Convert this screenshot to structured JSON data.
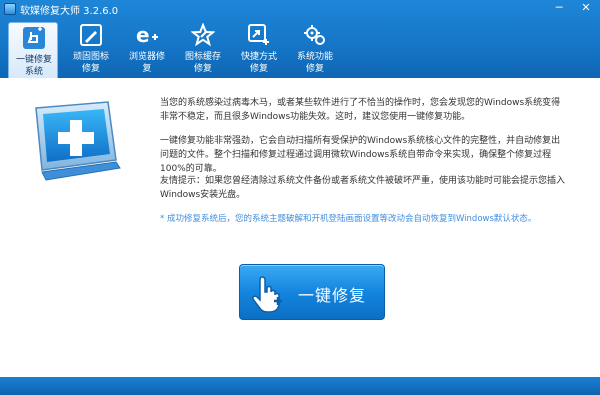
{
  "window": {
    "title": "软媒修复大师 3.2.6.0",
    "min_label": "─",
    "close_label": "✕"
  },
  "toolbar": {
    "items": [
      {
        "label": "一键修复\n系统",
        "icon": "hand-plus-icon",
        "active": true
      },
      {
        "label": "顽固图标\n修复",
        "icon": "brush-icon",
        "active": false
      },
      {
        "label": "浏览器修\n复",
        "icon": "ie-plus-icon",
        "active": false
      },
      {
        "label": "图标缓存\n修复",
        "icon": "star-icon",
        "active": false
      },
      {
        "label": "快捷方式\n修复",
        "icon": "shortcut-icon",
        "active": false
      },
      {
        "label": "系统功能\n修复",
        "icon": "gears-icon",
        "active": false
      }
    ]
  },
  "main": {
    "paragraph1": "当您的系统感染过病毒木马，或者某些软件进行了不恰当的操作时，您会发现您的Windows系统变得非常不稳定，而且很多Windows功能失效。这时，建议您使用一键修复功能。",
    "paragraph2": "一键修复功能非常强劲，它会自动扫描所有受保护的Windows系统核心文件的完整性，并自动修复出问题的文件。整个扫描和修复过程通过调用微软Windows系统自带命令来实现，确保整个修复过程100%的可靠。",
    "paragraph3": "友情提示：如果您曾经清除过系统文件备份或者系统文件被破坏严重，使用该功能时可能会提示您插入Windows安装光盘。",
    "note": "* 成功修复系统后，您的系统主题破解和开机登陆画面设置等改动会自动恢复到Windows默认状态。",
    "fix_button_label": "一键修复"
  },
  "colors": {
    "header": "#1677c8",
    "accent": "#1485df",
    "note": "#3f8fe0"
  }
}
